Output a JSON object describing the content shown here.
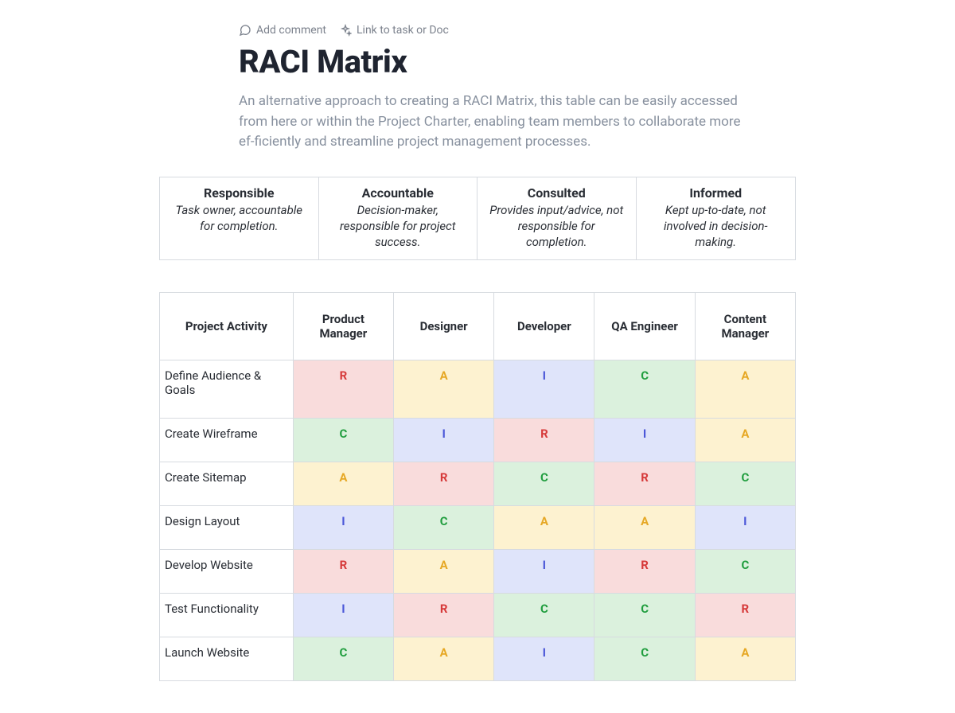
{
  "actions": {
    "add_comment": "Add comment",
    "link_doc": "Link to task or Doc"
  },
  "title": "RACI Matrix",
  "intro": "An alternative approach to creating a RACI Matrix, this table can be easily accessed from here or within the Project Charter, enabling team members to collaborate more ef‑ficiently and streamline project management processes.",
  "legend": [
    {
      "title": "Responsible",
      "desc": "Task owner, accountable for completion."
    },
    {
      "title": "Accountable",
      "desc": "Decision-maker, responsible for project success."
    },
    {
      "title": "Consulted",
      "desc": "Provides input/advice, not responsible for completion."
    },
    {
      "title": "Informed",
      "desc": "Kept up-to-date, not involved in decision-making."
    }
  ],
  "columns": [
    "Project Activity",
    "Product Manager",
    "Designer",
    "Developer",
    "QA Engineer",
    "Content Manager"
  ],
  "rows": [
    {
      "activity": "Define Audience & Goals",
      "cells": [
        "R",
        "A",
        "I",
        "C",
        "A"
      ]
    },
    {
      "activity": "Create Wireframe",
      "cells": [
        "C",
        "I",
        "R",
        "I",
        "A"
      ]
    },
    {
      "activity": "Create Sitemap",
      "cells": [
        "A",
        "R",
        "C",
        "R",
        "C"
      ]
    },
    {
      "activity": "Design Layout",
      "cells": [
        "I",
        "C",
        "A",
        "A",
        "I"
      ]
    },
    {
      "activity": "Develop Website",
      "cells": [
        "R",
        "A",
        "I",
        "R",
        "C"
      ]
    },
    {
      "activity": "Test Functionality",
      "cells": [
        "I",
        "R",
        "C",
        "C",
        "R"
      ]
    },
    {
      "activity": "Launch Website",
      "cells": [
        "C",
        "A",
        "I",
        "C",
        "A"
      ]
    }
  ]
}
